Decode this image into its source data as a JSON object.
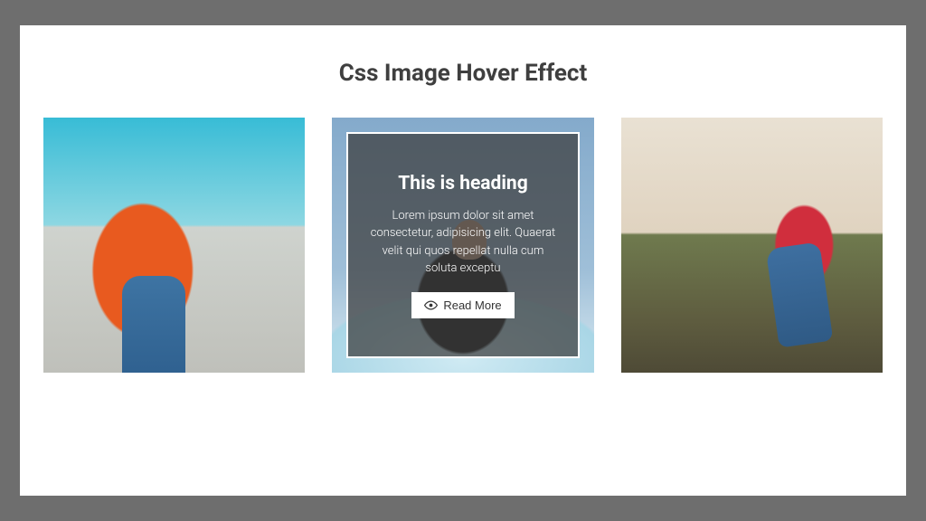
{
  "title": "Css Image Hover Effect",
  "cards": [
    {
      "alt": "woman-orange-shirt"
    },
    {
      "alt": "woman-black-top-overlay",
      "overlay": {
        "heading": "This is heading",
        "body": "Lorem ipsum dolor sit amet consectetur, adipisicing elit. Quaerat velit qui quos repellat nulla cum soluta exceptu",
        "button_label": "Read More"
      }
    },
    {
      "alt": "woman-on-rock"
    }
  ]
}
